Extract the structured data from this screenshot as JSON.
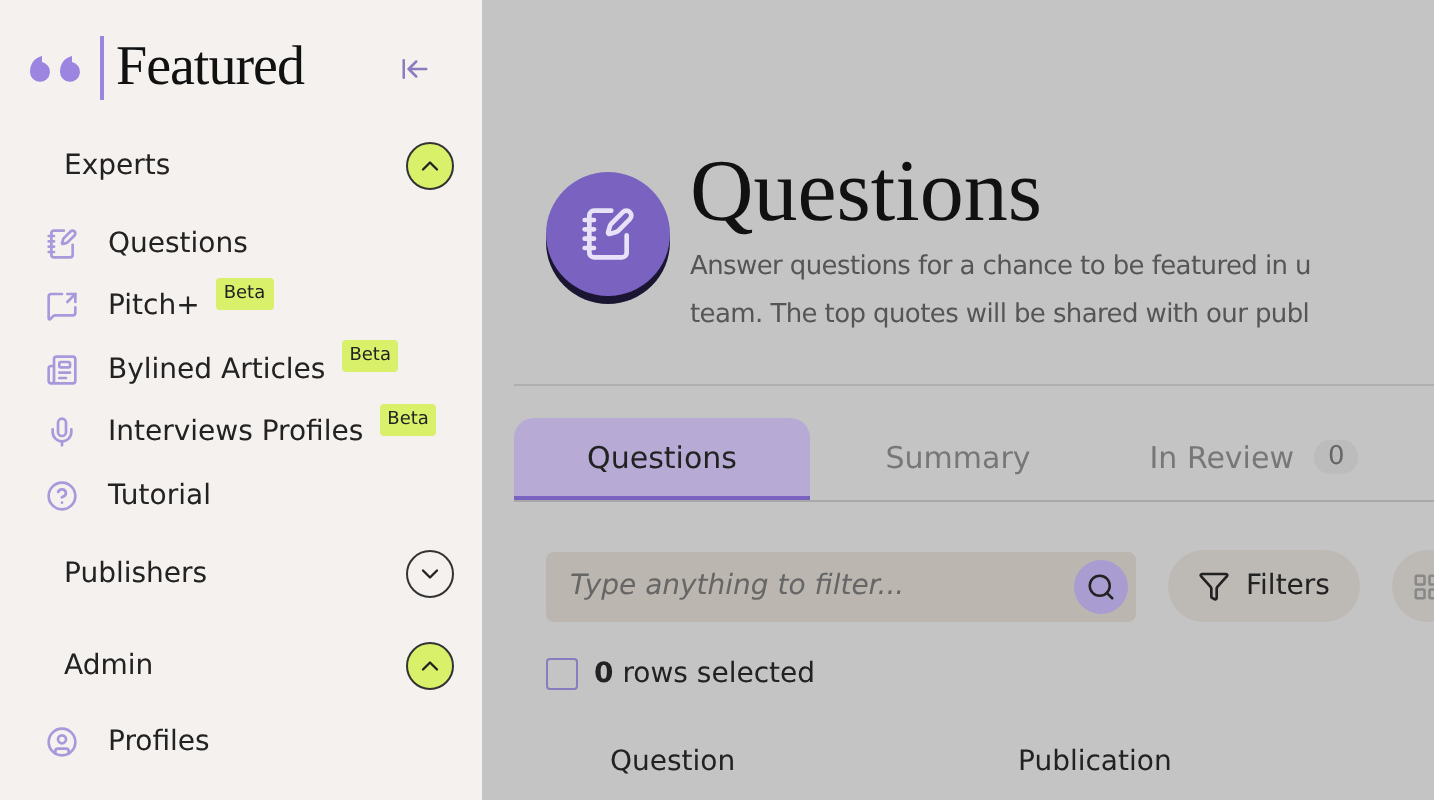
{
  "sidebar": {
    "logo": "Featured",
    "sections": [
      {
        "label": "Experts",
        "expanded": true,
        "items": [
          {
            "label": "Questions"
          },
          {
            "label": "Pitch+",
            "badge": "Beta"
          },
          {
            "label": "Bylined Articles",
            "badge": "Beta"
          },
          {
            "label": "Interviews Profiles",
            "badge": "Beta"
          },
          {
            "label": "Tutorial"
          }
        ]
      },
      {
        "label": "Publishers",
        "expanded": false
      },
      {
        "label": "Admin",
        "expanded": true,
        "items": [
          {
            "label": "Profiles"
          }
        ]
      }
    ]
  },
  "page": {
    "title": "Questions",
    "description_lines": [
      "Answer questions for a chance to be featured in u",
      "team. The top quotes will be shared with our publ"
    ]
  },
  "tabs": [
    {
      "label": "Questions",
      "selected": true
    },
    {
      "label": "Summary",
      "selected": false
    },
    {
      "label": "In Review",
      "count": "0",
      "selected": false
    }
  ],
  "filter": {
    "placeholder": "Type anything to filter...",
    "button": "Filters"
  },
  "selection": {
    "checked": false,
    "text": "**0** rows selected"
  },
  "table": {
    "columns": [
      "Question",
      "Publication"
    ]
  }
}
